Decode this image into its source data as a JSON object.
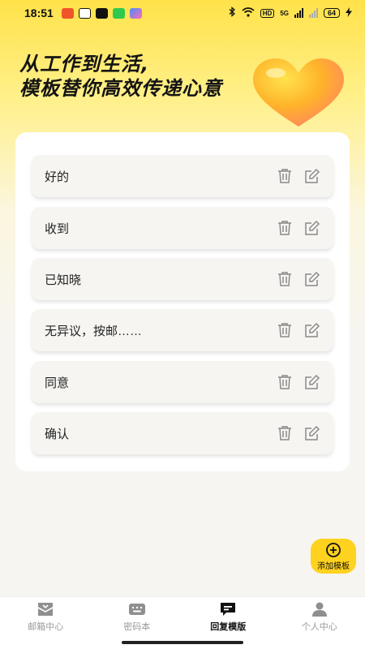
{
  "status_bar": {
    "time": "18:51",
    "hd_label": "HD",
    "network_label": "5G",
    "battery": "64"
  },
  "hero": {
    "line1": "从工作到生活,",
    "line2": "模板替你高效传递心意"
  },
  "templates": [
    {
      "text": "好的"
    },
    {
      "text": "收到"
    },
    {
      "text": "已知晓"
    },
    {
      "text": "无异议，按邮……"
    },
    {
      "text": "同意"
    },
    {
      "text": "确认"
    }
  ],
  "add_button": {
    "label": "添加模板",
    "icon": "plus-circle-icon"
  },
  "tabbar": [
    {
      "label": "邮箱中心",
      "icon": "mailbox-icon",
      "active": false
    },
    {
      "label": "密码本",
      "icon": "keyboard-icon",
      "active": false
    },
    {
      "label": "回复模版",
      "icon": "chat-bubble-icon",
      "active": true
    },
    {
      "label": "个人中心",
      "icon": "person-icon",
      "active": false
    }
  ],
  "colors": {
    "accent": "#ffd21f",
    "background": "#f6f5f1",
    "icon_gray": "#8a8a8a"
  }
}
